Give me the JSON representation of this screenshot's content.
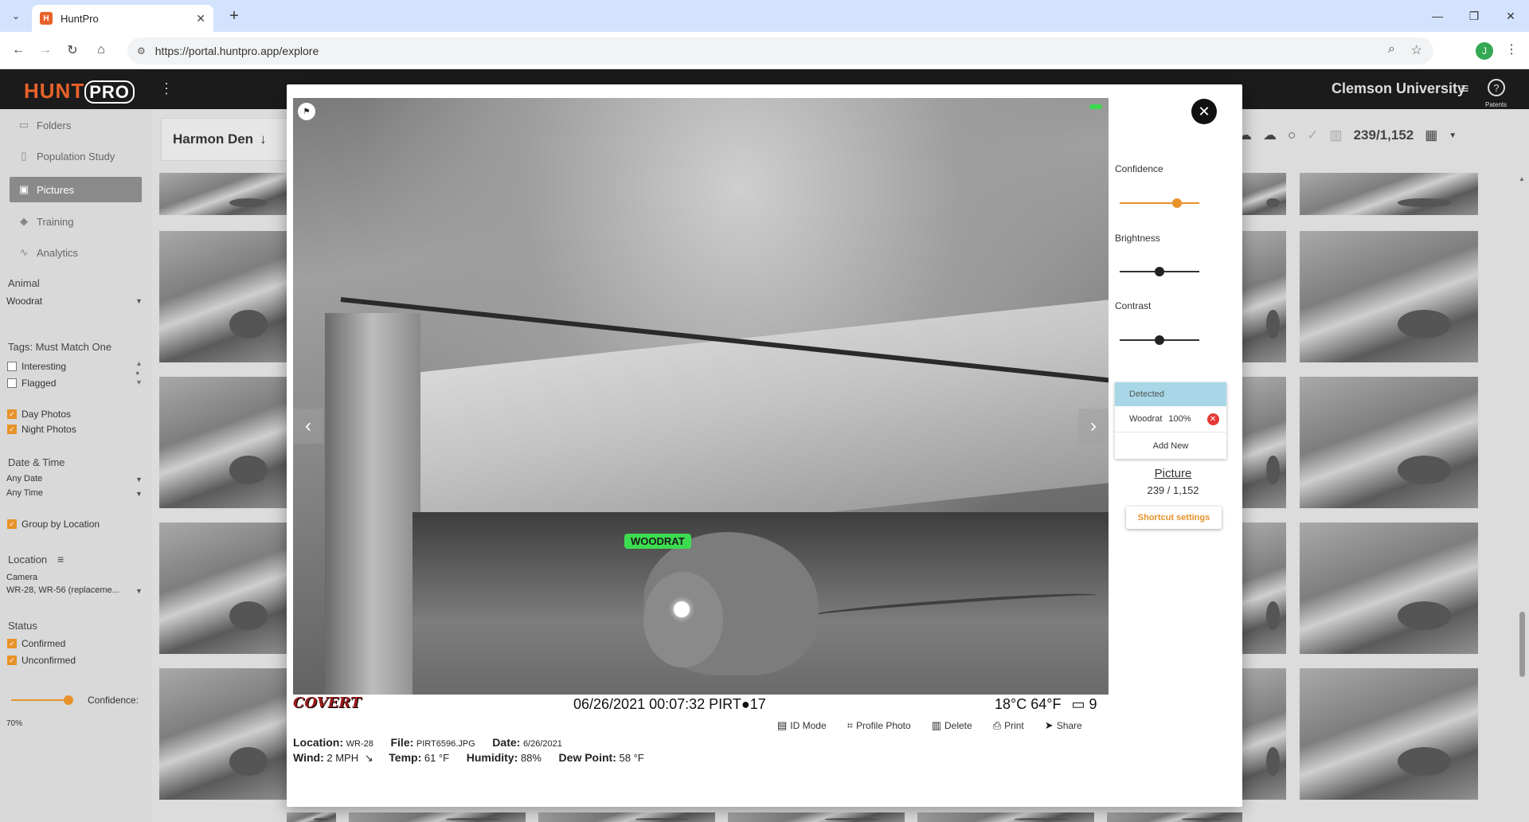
{
  "browser": {
    "tab_title": "HuntPro",
    "url": "https://portal.huntpro.app/explore",
    "profile_initial": "J"
  },
  "app": {
    "logo_hunt": "HUNT",
    "logo_pro": "PRO",
    "org_name": "Clemson University",
    "help_label": "Patents"
  },
  "sidebar": {
    "nav": [
      {
        "label": "Folders",
        "icon": "folder-icon"
      },
      {
        "label": "Population Study",
        "icon": "document-icon"
      },
      {
        "label": "Pictures",
        "icon": "image-icon"
      },
      {
        "label": "Training",
        "icon": "graduation-cap-icon"
      },
      {
        "label": "Analytics",
        "icon": "chart-line-icon"
      }
    ],
    "animal_label": "Animal",
    "animal_value": "Woodrat",
    "tags_label": "Tags: Must Match One",
    "tag_options": [
      {
        "label": "Interesting",
        "checked": false
      },
      {
        "label": "Flagged",
        "checked": false
      }
    ],
    "photo_options": [
      {
        "label": "Day Photos",
        "checked": true
      },
      {
        "label": "Night Photos",
        "checked": true
      }
    ],
    "datetime_label": "Date & Time",
    "date_value": "Any Date",
    "time_value": "Any Time",
    "group_by_location": "Group by Location",
    "location_label": "Location",
    "camera_label": "Camera",
    "camera_value": "WR-28, WR-56 (replaceme...",
    "status_label": "Status",
    "status_options": [
      {
        "label": "Confirmed",
        "checked": true
      },
      {
        "label": "Unconfirmed",
        "checked": true
      }
    ],
    "confidence_label": "Confidence:",
    "confidence_value": "70%",
    "confidence_level": 0.65
  },
  "gallery": {
    "folder_name": "Harmon Den",
    "count": "239/1,152"
  },
  "modal": {
    "detection_tag": "WOODRAT",
    "stamp_datetime": "06/26/2021  00:07:32 PIRT",
    "stamp_seq": "17",
    "stamp_temp": "18°C  64°F",
    "stamp_battery": "9",
    "stamp_brand": "COVERT",
    "actions": [
      {
        "label": "ID Mode",
        "icon": "id-card-icon"
      },
      {
        "label": "Profile Photo",
        "icon": "crop-icon"
      },
      {
        "label": "Delete",
        "icon": "trash-icon"
      },
      {
        "label": "Print",
        "icon": "printer-icon"
      },
      {
        "label": "Share",
        "icon": "share-icon"
      }
    ],
    "meta1": {
      "location_label": "Location:",
      "location_value": "WR-28",
      "file_label": "File:",
      "file_value": "PIRT6596.JPG",
      "date_label": "Date:",
      "date_value": "6/26/2021"
    },
    "meta2": {
      "wind_label": "Wind:",
      "wind_value": "2 MPH",
      "temp_label": "Temp:",
      "temp_value": "61 °F",
      "humidity_label": "Humidity:",
      "humidity_value": "88%",
      "dew_label": "Dew Point:",
      "dew_value": "58 °F"
    },
    "confidence_label": "Confidence",
    "confidence_level": 0.72,
    "brightness_label": "Brightness",
    "brightness_level": 0.5,
    "contrast_label": "Contrast",
    "contrast_level": 0.5,
    "detected_header": "Detected",
    "detected_items": [
      {
        "name": "Woodrat",
        "confidence": "100%"
      }
    ],
    "add_new": "Add New",
    "picture_link": "Picture",
    "picture_count": "239 / 1,152",
    "shortcut_settings": "Shortcut settings"
  },
  "colors": {
    "accent": "#e8922a",
    "brand": "#e8622a",
    "detected_bg": "#a8d8e8",
    "detection_tag": "#3ddc50",
    "remove": "#e53935"
  }
}
